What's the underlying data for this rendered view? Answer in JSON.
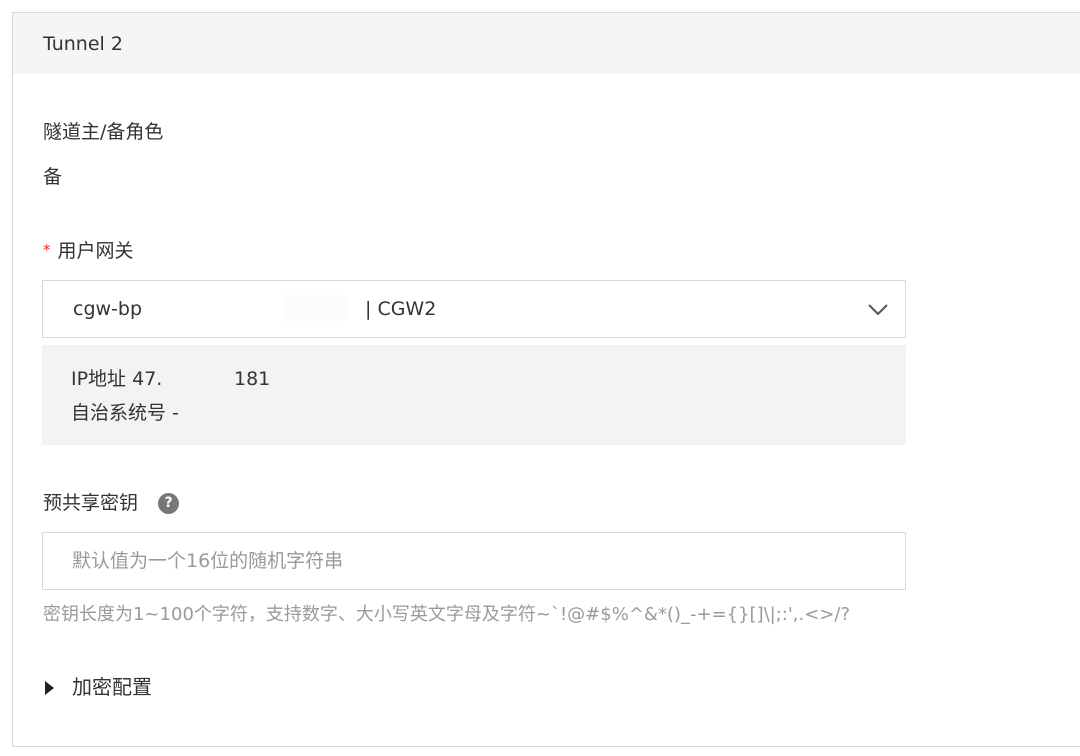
{
  "panel": {
    "title": "Tunnel 2"
  },
  "role": {
    "label": "隧道主/备角色",
    "value": "备"
  },
  "gateway": {
    "required_mark": "*",
    "label": "用户网关",
    "selected_id": "cgw-bp",
    "selected_name": "| CGW2",
    "icon": "chevron-down-icon",
    "info": {
      "ip_label": "IP地址 47.",
      "ip_suffix": "181",
      "asn_label": "自治系统号 -"
    }
  },
  "psk": {
    "label": "预共享密钥",
    "help_icon": "question-circle-icon",
    "help_text": "?",
    "placeholder": "默认值为一个16位的随机字符串",
    "value": "",
    "hint": "密钥长度为1~100个字符，支持数字、大小写英文字母及字符~`!@#$%^&*()_-+={}[]\\|;:',.<>/?"
  },
  "encryption": {
    "label": "加密配置",
    "expanded": false
  },
  "colors": {
    "required": "#e0312d",
    "header_bg": "#f5f5f5",
    "info_bg": "#f3f3f3",
    "border": "#d9d9d9",
    "hint_text": "#9a9a9a"
  }
}
